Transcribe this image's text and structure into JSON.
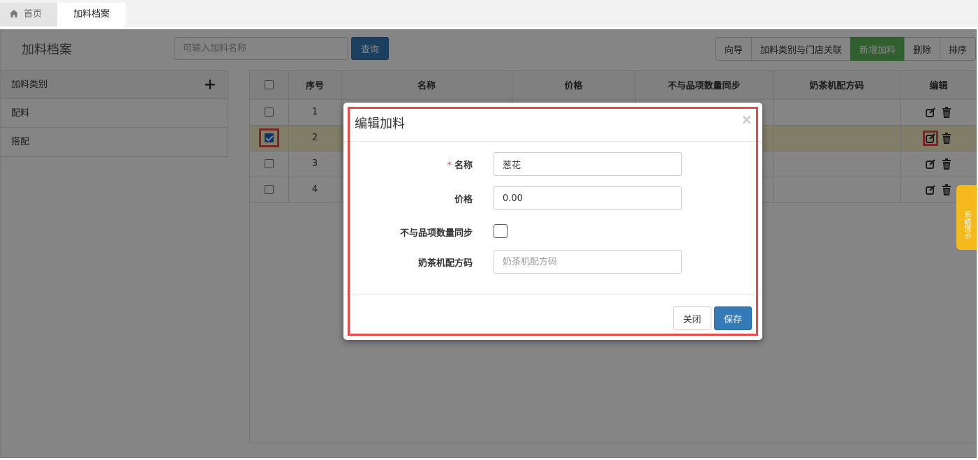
{
  "tabs": [
    {
      "label": "首页",
      "icon": "home-icon"
    },
    {
      "label": "加料档案"
    }
  ],
  "page": {
    "title": "加料档案",
    "search_placeholder": "可输入加料名称",
    "query_label": "查询"
  },
  "toolbar": {
    "guide": "向导",
    "category_store_link": "加料类别与门店关联",
    "add_topping": "新增加料",
    "delete": "删除",
    "sort": "排序"
  },
  "sidebar": {
    "header": "加料类别",
    "items": [
      "配料",
      "搭配"
    ]
  },
  "table": {
    "headers": [
      "序号",
      "名称",
      "价格",
      "不与品项数量同步",
      "奶茶机配方码",
      "编辑"
    ],
    "rows": [
      {
        "index": "1",
        "checked": false
      },
      {
        "index": "2",
        "checked": true
      },
      {
        "index": "3",
        "checked": false
      },
      {
        "index": "4",
        "checked": false
      }
    ]
  },
  "side_tip": "系统提示",
  "modal": {
    "title": "编辑加料",
    "close_x": "×",
    "fields": {
      "name_label": "名称",
      "name_value": "葱花",
      "price_label": "价格",
      "price_value": "0.00",
      "no_sync_label": "不与品项数量同步",
      "recipe_label": "奶茶机配方码",
      "recipe_placeholder": "奶茶机配方码"
    },
    "close_btn": "关闭",
    "save_btn": "保存"
  }
}
